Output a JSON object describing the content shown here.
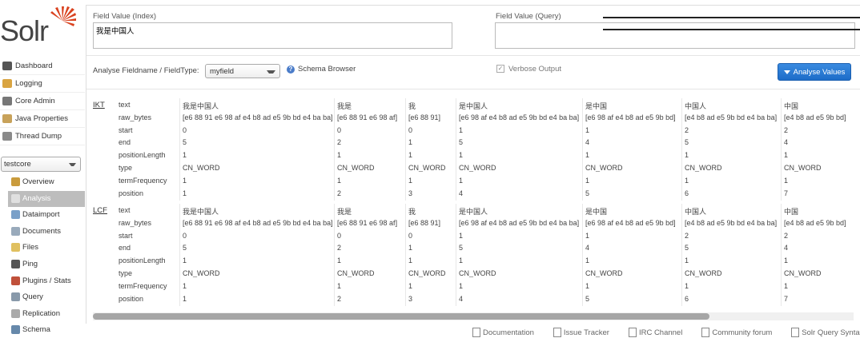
{
  "app": {
    "logo_text": "Solr"
  },
  "sidebar": {
    "items": [
      {
        "label": "Dashboard",
        "icon": "dashboard-icon",
        "color": "#555555"
      },
      {
        "label": "Logging",
        "icon": "logging-icon",
        "color": "#d9a441"
      },
      {
        "label": "Core Admin",
        "icon": "core-admin-icon",
        "color": "#777777"
      },
      {
        "label": "Java Properties",
        "icon": "java-properties-icon",
        "color": "#c8a25a"
      },
      {
        "label": "Thread Dump",
        "icon": "thread-dump-icon",
        "color": "#8a8a8a"
      }
    ],
    "core_selector": {
      "value": "testcore"
    },
    "core_items": [
      {
        "label": "Overview",
        "icon": "overview-icon",
        "color": "#c99b3c"
      },
      {
        "label": "Analysis",
        "icon": "analysis-icon",
        "color": "#e0e0e0",
        "selected": true
      },
      {
        "label": "Dataimport",
        "icon": "dataimport-icon",
        "color": "#7aa0c8"
      },
      {
        "label": "Documents",
        "icon": "documents-icon",
        "color": "#9ab"
      },
      {
        "label": "Files",
        "icon": "files-icon",
        "color": "#e0c060"
      },
      {
        "label": "Ping",
        "icon": "ping-icon",
        "color": "#555555"
      },
      {
        "label": "Plugins / Stats",
        "icon": "plugins-icon",
        "color": "#c0503a"
      },
      {
        "label": "Query",
        "icon": "query-icon",
        "color": "#8899aa"
      },
      {
        "label": "Replication",
        "icon": "replication-icon",
        "color": "#aaaaaa"
      },
      {
        "label": "Schema",
        "icon": "schema-icon",
        "color": "#6688aa"
      }
    ]
  },
  "form": {
    "index_label": "Field Value (Index)",
    "index_value": "我是中国人",
    "query_label": "Field Value (Query)",
    "query_value": "",
    "fieldname_label": "Analyse Fieldname / FieldType:",
    "fieldname_value": "myfield",
    "schema_browser": "Schema Browser",
    "verbose_label": "Verbose Output",
    "verbose_checked": true,
    "analyse_button": "Analyse Values",
    "accent": "#1d6cc8"
  },
  "analysis": {
    "row_labels": [
      "text",
      "raw_bytes",
      "start",
      "end",
      "positionLength",
      "type",
      "termFrequency",
      "position"
    ],
    "stages": [
      {
        "abbr": "IKT",
        "tokens": [
          [
            "我是中国人",
            "[e6 88 91 e6 98 af e4 b8 ad e5 9b bd e4 ba ba]",
            "0",
            "5",
            "1",
            "CN_WORD",
            "1",
            "1"
          ],
          [
            "我是",
            "[e6 88 91 e6 98 af]",
            "0",
            "2",
            "1",
            "CN_WORD",
            "1",
            "2"
          ],
          [
            "我",
            "[e6 88 91]",
            "0",
            "1",
            "1",
            "CN_WORD",
            "1",
            "3"
          ],
          [
            "是中国人",
            "[e6 98 af e4 b8 ad e5 9b bd e4 ba ba]",
            "1",
            "5",
            "1",
            "CN_WORD",
            "1",
            "4"
          ],
          [
            "是中国",
            "[e6 98 af e4 b8 ad e5 9b bd]",
            "1",
            "4",
            "1",
            "CN_WORD",
            "1",
            "5"
          ],
          [
            "中国人",
            "[e4 b8 ad e5 9b bd e4 ba ba]",
            "2",
            "5",
            "1",
            "CN_WORD",
            "1",
            "6"
          ],
          [
            "中国",
            "[e4 b8 ad e5 9b bd]",
            "2",
            "4",
            "1",
            "CN_WORD",
            "1",
            "7"
          ]
        ]
      },
      {
        "abbr": "LCF",
        "tokens": [
          [
            "我是中国人",
            "[e6 88 91 e6 98 af e4 b8 ad e5 9b bd e4 ba ba]",
            "0",
            "5",
            "1",
            "CN_WORD",
            "1",
            "1"
          ],
          [
            "我是",
            "[e6 88 91 e6 98 af]",
            "0",
            "2",
            "1",
            "CN_WORD",
            "1",
            "2"
          ],
          [
            "我",
            "[e6 88 91]",
            "0",
            "1",
            "1",
            "CN_WORD",
            "1",
            "3"
          ],
          [
            "是中国人",
            "[e6 98 af e4 b8 ad e5 9b bd e4 ba ba]",
            "1",
            "5",
            "1",
            "CN_WORD",
            "1",
            "4"
          ],
          [
            "是中国",
            "[e6 98 af e4 b8 ad e5 9b bd]",
            "1",
            "4",
            "1",
            "CN_WORD",
            "1",
            "5"
          ],
          [
            "中国人",
            "[e4 b8 ad e5 9b bd e4 ba ba]",
            "2",
            "5",
            "1",
            "CN_WORD",
            "1",
            "6"
          ],
          [
            "中国",
            "[e4 b8 ad e5 9b bd]",
            "2",
            "4",
            "1",
            "CN_WORD",
            "1",
            "7"
          ]
        ]
      }
    ]
  },
  "footer": {
    "links": [
      "Documentation",
      "Issue Tracker",
      "IRC Channel",
      "Community forum",
      "Solr Query Syntax"
    ]
  }
}
